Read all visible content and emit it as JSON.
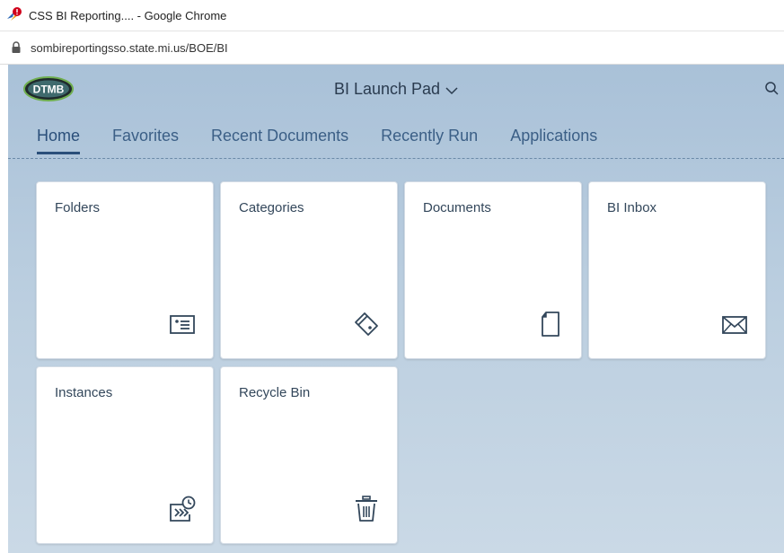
{
  "browser": {
    "window_title": "CSS BI Reporting.... - Google Chrome",
    "url": "sombireportingsso.state.mi.us/BOE/BI"
  },
  "header": {
    "logo_text": "DTMB",
    "title": "BI Launch Pad"
  },
  "tabs": [
    {
      "label": "Home",
      "active": true
    },
    {
      "label": "Favorites"
    },
    {
      "label": "Recent Documents"
    },
    {
      "label": "Recently Run"
    },
    {
      "label": "Applications"
    }
  ],
  "tiles": [
    {
      "label": "Folders",
      "icon": "folder-card-icon"
    },
    {
      "label": "Categories",
      "icon": "tag-icon"
    },
    {
      "label": "Documents",
      "icon": "document-icon"
    },
    {
      "label": "BI Inbox",
      "icon": "envelope-icon"
    },
    {
      "label": "Instances",
      "icon": "scheduled-instances-icon"
    },
    {
      "label": "Recycle Bin",
      "icon": "trash-icon"
    }
  ],
  "colors": {
    "accent": "#2a4f7a",
    "tab_text": "#3b5f86"
  }
}
